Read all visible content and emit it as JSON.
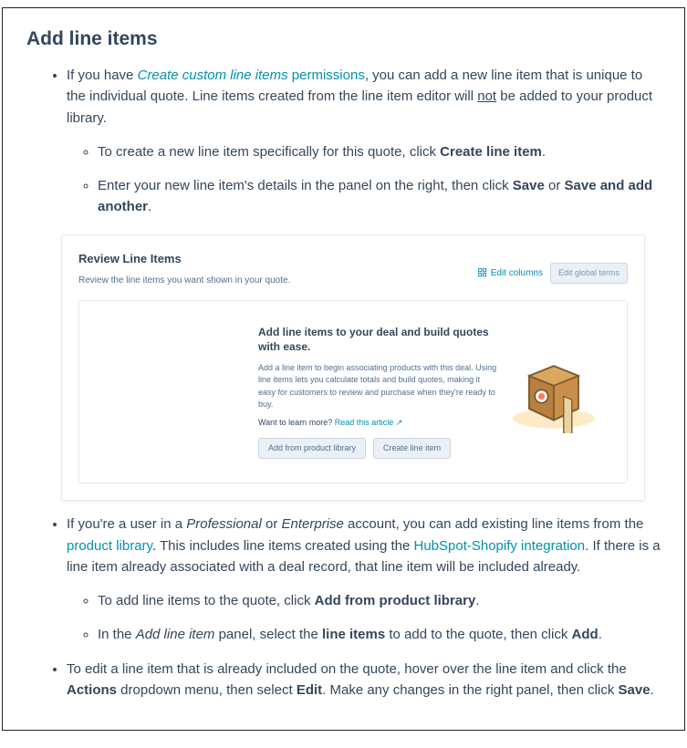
{
  "heading": "Add line items",
  "bullet1": {
    "prefix": "If you have ",
    "perm_link_italic": "Create custom line items",
    "perm_link_rest": " permissions",
    "after": ", you can add a new line item that is unique to the individual quote. Line items created from the line item editor will ",
    "not": "not",
    "tail": " be added to your product library.",
    "sub1_pre": "To create a new line item specifically for this quote, click ",
    "sub1_bold": "Create line item",
    "sub1_post": ".",
    "sub2_pre": "Enter your new line item's details in the panel on the right, then click ",
    "sub2_b1": "Save",
    "sub2_or": " or ",
    "sub2_b2": "Save and add another",
    "sub2_post": "."
  },
  "panel": {
    "title": "Review Line Items",
    "subtitle": "Review the line items you want shown in your quote.",
    "edit_columns": "Edit columns",
    "edit_global": "Edit global terms",
    "promo_title": "Add line items to your deal and build quotes with ease.",
    "promo_desc": "Add a line item to begin associating products with this deal. Using line items lets you calculate totals and build quotes, making it easy for customers to review and purchase when they're ready to buy.",
    "promo_learn_pre": "Want to learn more? ",
    "promo_learn_link": "Read this article",
    "btn_add_lib": "Add from product library",
    "btn_create": "Create line item"
  },
  "bullet2": {
    "pre": "If you're a user in a ",
    "prof": "Professional",
    "mid1": " or ",
    "ent": "Enterprise",
    "mid2": " account, you can add existing line items from the ",
    "prod_lib": "product library",
    "mid3": ". This includes line items created using the ",
    "shopify": "HubSpot-Shopify integration",
    "tail": ". If there is a line item already associated with a deal record, that line item will be included already.",
    "sub1_pre": "To add line items to the quote, click ",
    "sub1_bold": "Add from product library",
    "sub1_post": ".",
    "sub2_pre": "In the ",
    "sub2_i": "Add line item",
    "sub2_mid": " panel, select the ",
    "sub2_b": "line items",
    "sub2_mid2": " to add to the quote, then click ",
    "sub2_b2": "Add",
    "sub2_post": "."
  },
  "bullet3": {
    "pre": "To edit a line item that is already included on the quote, hover over the line item and click the ",
    "b1": "Actions",
    "mid1": " dropdown menu, then select ",
    "b2": "Edit",
    "mid2": ". Make any changes in the right panel, then click ",
    "b3": "Save",
    "post": "."
  }
}
